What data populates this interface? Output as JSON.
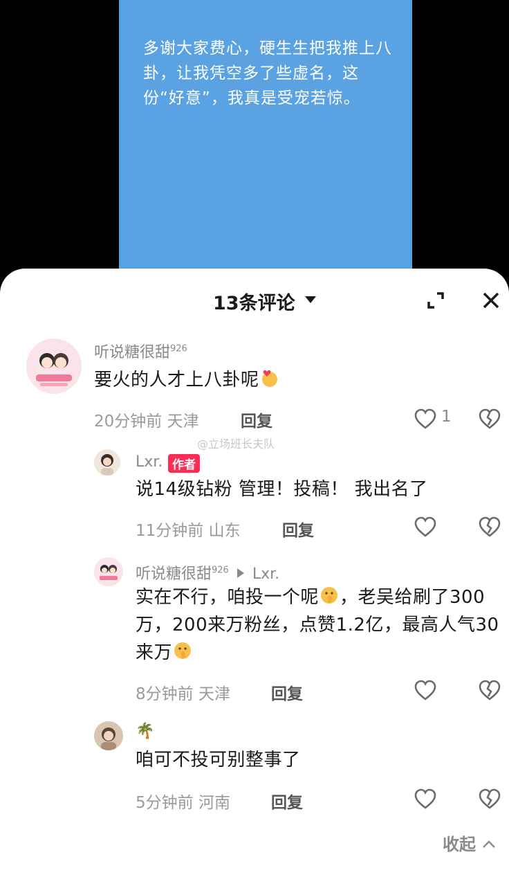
{
  "post": {
    "text": "多谢大家费心，硬生生把我推上八卦，让我凭空多了些虚名，这份“好意”，我真是受宠若惊。"
  },
  "header": {
    "comment_count": "13条评论"
  },
  "watermark": "@立场班长夫队",
  "comments": [
    {
      "username": "听说糖很甜",
      "badge_number": "926",
      "text": "要火的人才上八卦呢",
      "emoji": "heart-hands-emoji",
      "time": "20分钟前",
      "location": "天津",
      "reply_label": "回复",
      "likes": "1"
    },
    {
      "username": "Lxr.",
      "author_tag": "作者",
      "text": "说14级钻粉 管理！投稿！ 我出名了",
      "time": "11分钟前",
      "location": "山东",
      "reply_label": "回复"
    },
    {
      "username": "听说糖很甜",
      "badge_number": "926",
      "reply_to": "Lxr.",
      "text_part1": "实在不行，咱投一个呢",
      "text_part2": "，老吴给刷了300万，200来万粉丝，点赞1.2亿，最高人气30来万",
      "emoji": "shushing-face-emoji",
      "time": "8分钟前",
      "location": "天津",
      "reply_label": "回复"
    },
    {
      "username": "🌴",
      "text": "咱可不投可别整事了",
      "time": "5分钟前",
      "location": "河南",
      "reply_label": "回复"
    }
  ],
  "footer": {
    "collapse_label": "收起"
  },
  "colors": {
    "post_background": "#5aa2e2",
    "author_badge": "#fe2c55"
  }
}
